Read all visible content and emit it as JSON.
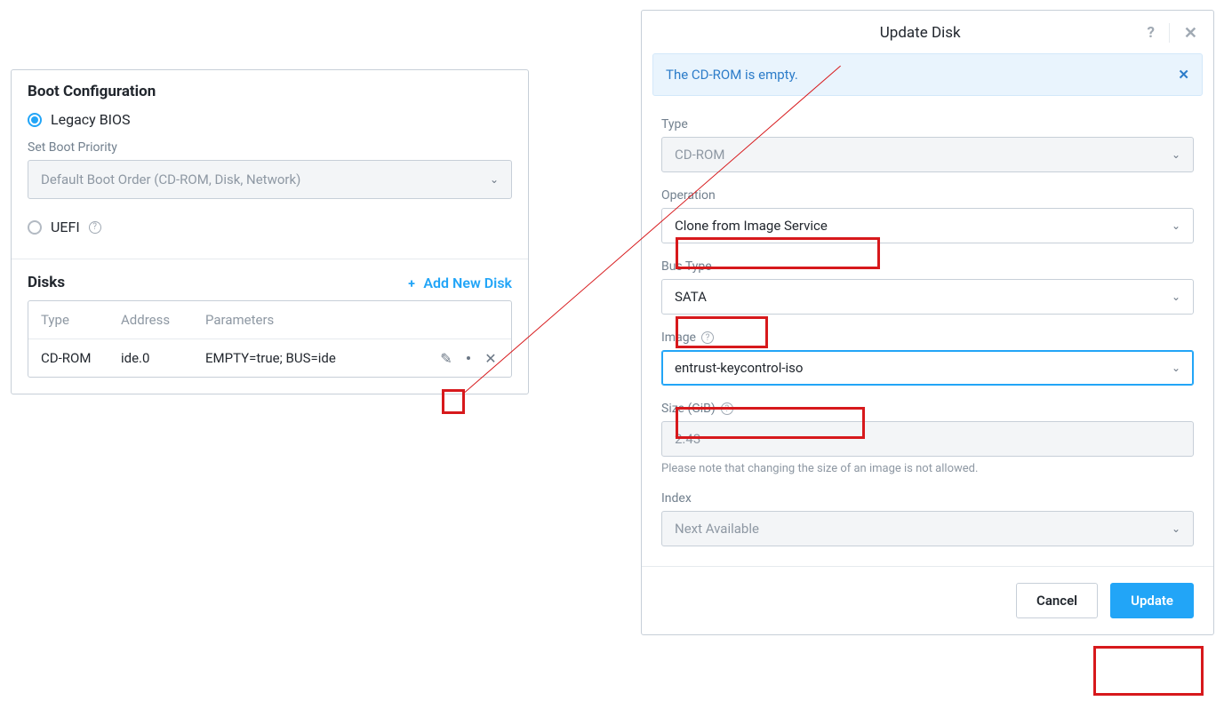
{
  "boot": {
    "section_title": "Boot Configuration",
    "legacy_label": "Legacy BIOS",
    "uefi_label": "UEFI",
    "priority_label": "Set Boot Priority",
    "priority_value": "Default Boot Order (CD-ROM, Disk, Network)"
  },
  "disks": {
    "section_title": "Disks",
    "add_label": "Add New Disk",
    "headers": {
      "type": "Type",
      "address": "Address",
      "parameters": "Parameters"
    },
    "rows": [
      {
        "type": "CD-ROM",
        "address": "ide.0",
        "parameters": "EMPTY=true; BUS=ide"
      }
    ]
  },
  "dialog": {
    "title": "Update Disk",
    "alert": "The CD-ROM is empty.",
    "type_label": "Type",
    "type_value": "CD-ROM",
    "operation_label": "Operation",
    "operation_value": "Clone from Image Service",
    "bus_label": "Bus Type",
    "bus_value": "SATA",
    "image_label": "Image",
    "image_value": "entrust-keycontrol-iso",
    "size_label": "Size (GiB)",
    "size_value": "2.43",
    "size_note": "Please note that changing the size of an image is not allowed.",
    "index_label": "Index",
    "index_value": "Next Available",
    "cancel": "Cancel",
    "update": "Update"
  }
}
